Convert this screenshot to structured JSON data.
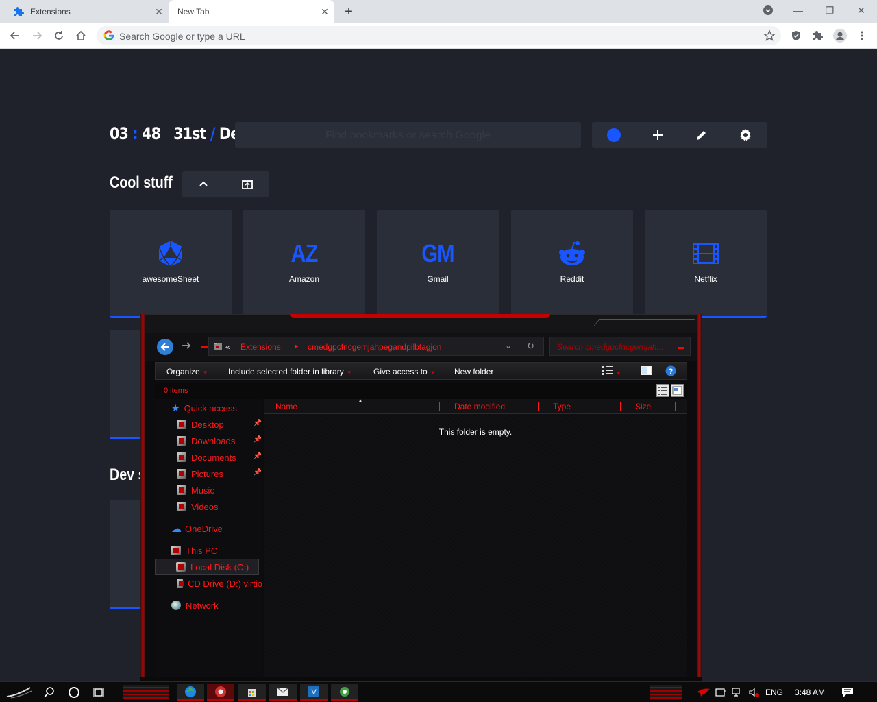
{
  "browser": {
    "tabs": [
      {
        "label": "Extensions",
        "icon": "puzzle-icon"
      },
      {
        "label": "New Tab",
        "icon": ""
      }
    ],
    "omnibox_placeholder": "Search Google or type a URL"
  },
  "ntp": {
    "clock": {
      "hours": "03",
      "sep": ":",
      "minutes": "48",
      "day": "31st",
      "slash": "/",
      "month": "Dec"
    },
    "search_placeholder": "Find bookmarks or search Google",
    "accent": "#1a56ff",
    "section1_title": "Cool stuff",
    "section2_title": "Dev s",
    "tiles": [
      {
        "label": "awesomeSheet",
        "icon": "d20-icon"
      },
      {
        "label": "Amazon",
        "text": "AZ"
      },
      {
        "label": "Gmail",
        "text": "GM"
      },
      {
        "label": "Reddit",
        "icon": "reddit-icon"
      },
      {
        "label": "Netflix",
        "icon": "film-icon"
      }
    ]
  },
  "explorer": {
    "breadcrumb": [
      "«",
      "Extensions",
      "cmedgpcfncgemjahpegandpilbtagjon"
    ],
    "search_placeholder": "Search cmedgpcfncgemjah...",
    "commands": [
      "Organize",
      "Include selected folder in library",
      "Give access to",
      "New folder"
    ],
    "item_count": "0 items",
    "nav": {
      "quick_access": "Quick access",
      "items": [
        "Desktop",
        "Downloads",
        "Documents",
        "Pictures",
        "Music",
        "Videos"
      ],
      "onedrive": "OneDrive",
      "this_pc": "This PC",
      "local_disk": "Local Disk (C:)",
      "cd_drive": "CD Drive (D:) virtio",
      "network": "Network"
    },
    "columns": [
      "Name",
      "Date modified",
      "Type",
      "Size"
    ],
    "empty_message": "This folder is empty."
  },
  "taskbar": {
    "language": "ENG",
    "time": "3:48 AM",
    "accent": "#c00000"
  }
}
